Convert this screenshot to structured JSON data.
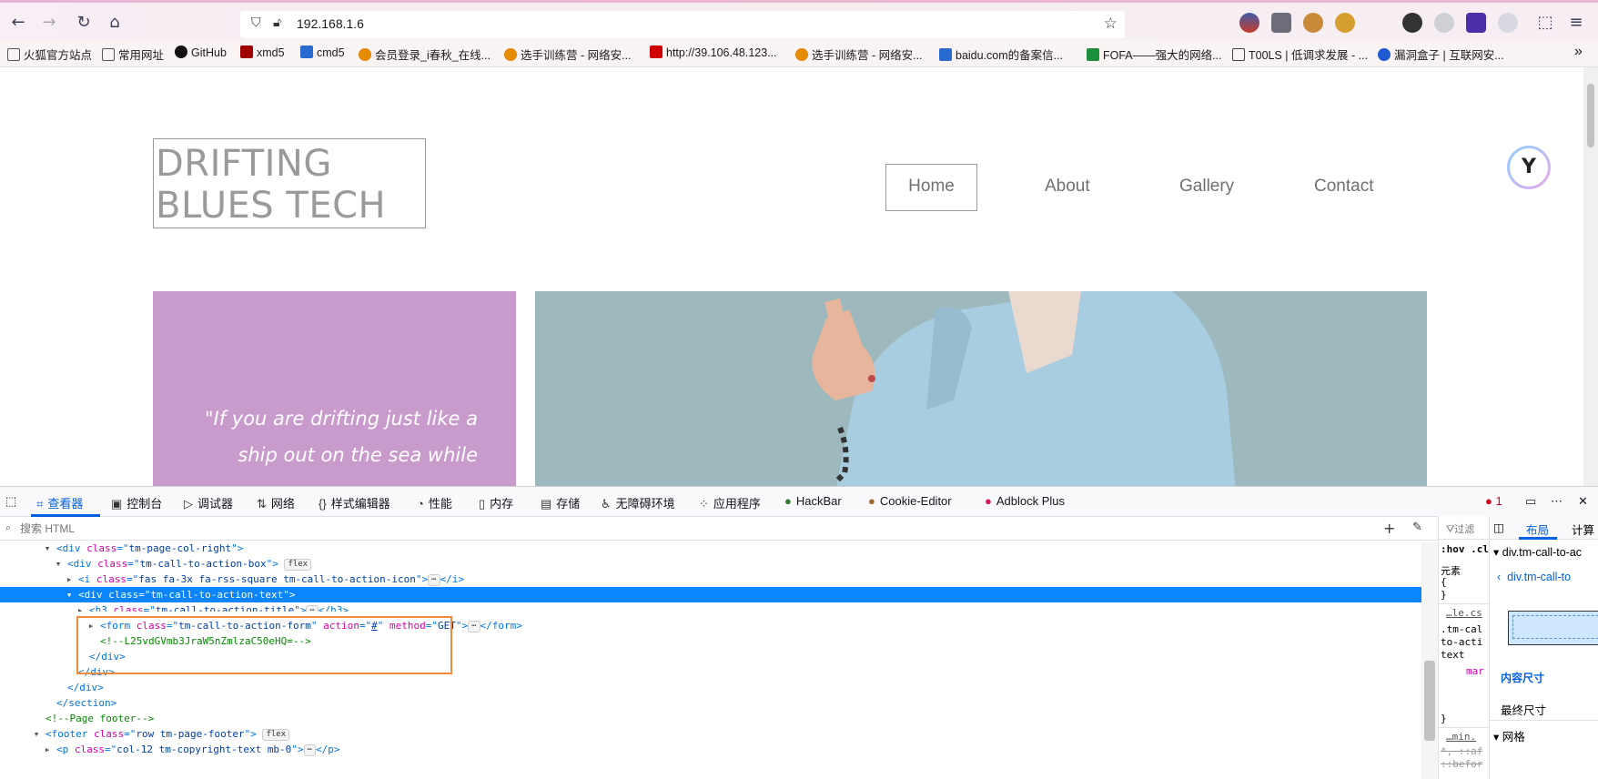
{
  "browser": {
    "url": "192.168.1.6",
    "bookmarks": [
      {
        "label": "火狐官方站点",
        "color": "#6b6b6b"
      },
      {
        "label": "常用网址",
        "color": "#6b6b6b"
      },
      {
        "label": "GitHub",
        "color": "#111111"
      },
      {
        "label": "xmd5",
        "color": "#a00000"
      },
      {
        "label": "cmd5",
        "color": "#2a6bd1"
      },
      {
        "label": "会员登录_i春秋_在线...",
        "color": "#e68a00"
      },
      {
        "label": "选手训练营 - 网络安...",
        "color": "#e68a00"
      },
      {
        "label": "http://39.106.48.123...",
        "color": "#d10000"
      },
      {
        "label": "选手训练营 - 网络安...",
        "color": "#e68a00"
      },
      {
        "label": "baidu.com的备案信...",
        "color": "#2a6bd1"
      },
      {
        "label": "FOFA——强大的网络...",
        "color": "#1e8f3d"
      },
      {
        "label": "T00LS | 低调求发展 - ...",
        "color": "#444444"
      },
      {
        "label": "漏洞盒子 | 互联网安...",
        "color": "#1e5bd1"
      }
    ]
  },
  "site": {
    "logo": "DRIFTING BLUES TECH",
    "nav": [
      "Home",
      "About",
      "Gallery",
      "Contact"
    ],
    "quote": "\"If you are drifting just like a ship out on the sea while"
  },
  "devtools": {
    "tabs": [
      "查看器",
      "控制台",
      "调试器",
      "网络",
      "样式编辑器",
      "性能",
      "内存",
      "存储",
      "无障碍环境",
      "应用程序",
      "HackBar",
      "Cookie-Editor",
      "Adblock Plus"
    ],
    "error_count": "1",
    "search_placeholder": "搜索 HTML",
    "rules_filter": "过滤",
    "layout_tabs": [
      "布局",
      "计算"
    ],
    "markup": {
      "l0": {
        "tag": "div",
        "cls_attr": "class",
        "cls": "tm-page-col-right"
      },
      "l1": {
        "tag": "div",
        "cls_attr": "class",
        "cls": "tm-call-to-action-box",
        "badge": "flex"
      },
      "l2": {
        "tag": "i",
        "cls_attr": "class",
        "cls": "fas fa-3x fa-rss-square tm-call-to-action-icon",
        "close": "</i>"
      },
      "l3": {
        "tag": "div",
        "cls_attr": "class",
        "cls": "tm-call-to-action-text"
      },
      "l4": {
        "tag": "h3",
        "cls_attr": "class",
        "cls": "tm-call-to-action-title",
        "close": "</h3>"
      },
      "l5": {
        "tag": "form",
        "cls_attr": "class",
        "cls": "tm-call-to-action-form",
        "a2": "action",
        "v2": "#",
        "a3": "method",
        "v3": "GET",
        "close": "</form>"
      },
      "l6": {
        "comment": "<!--L25vdGVmb3JraW5nZmlzaC50eHQ=-->"
      },
      "l7": "</div>",
      "l8": "</div>",
      "l9": "</div>",
      "l10": "</section>",
      "l11": {
        "comment": "<!--Page footer-->"
      },
      "l12": {
        "tag": "footer",
        "cls_attr": "class",
        "cls": "row tm-page-footer",
        "badge": "flex"
      },
      "l13": {
        "tag": "p",
        "cls_attr": "class",
        "cls": "col-12 tm-copyright-text mb-0",
        "close": "</p>"
      }
    },
    "rules": {
      "hov": ":hov .cl",
      "element": "元素",
      "brace_open": "{",
      "brace_close": "}",
      "file": "…le.cs",
      "sel1": ".tm-cal",
      "sel2": "to-acti",
      "sel3": "text",
      "margin": "mar",
      "file2": "…min.",
      "star": "*, ::af",
      "before": "::befor"
    },
    "layout": {
      "crumb": "div.tm-call-to-ac",
      "crumb2": "div.tm-call-to",
      "content_size": "内容尺寸",
      "final_size": "最终尺寸",
      "grid": "网格"
    }
  }
}
